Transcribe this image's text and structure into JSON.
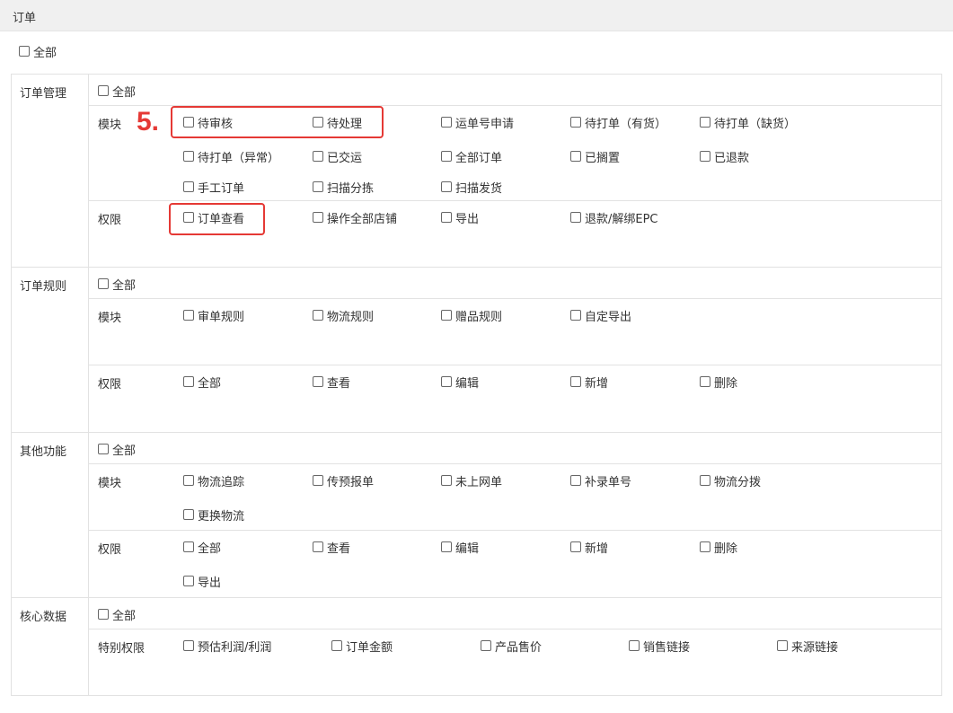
{
  "header": {
    "title": "订单"
  },
  "top_all": "全部",
  "annotation": {
    "step": "5."
  },
  "sections": [
    {
      "name": "订单管理",
      "all": "全部",
      "rows": [
        {
          "label": "模块",
          "items": [
            "待审核",
            "待处理",
            "运单号申请",
            "待打单（有货）",
            "待打单（缺货）",
            "待打单（异常）",
            "已交运",
            "全部订单",
            "已搁置",
            "已退款",
            "手工订单",
            "扫描分拣",
            "扫描发货"
          ]
        },
        {
          "label": "权限",
          "items": [
            "订单查看",
            "操作全部店铺",
            "导出",
            "退款/解绑EPC"
          ]
        }
      ]
    },
    {
      "name": "订单规则",
      "all": "全部",
      "rows": [
        {
          "label": "模块",
          "items": [
            "审单规则",
            "物流规则",
            "赠品规则",
            "自定导出"
          ]
        },
        {
          "label": "权限",
          "items": [
            "全部",
            "查看",
            "编辑",
            "新增",
            "删除"
          ]
        }
      ]
    },
    {
      "name": "其他功能",
      "all": "全部",
      "rows": [
        {
          "label": "模块",
          "items": [
            "物流追踪",
            "传预报单",
            "未上网单",
            "补录单号",
            "物流分拨",
            "更换物流"
          ]
        },
        {
          "label": "权限",
          "items": [
            "全部",
            "查看",
            "编辑",
            "新增",
            "删除",
            "导出"
          ]
        }
      ]
    },
    {
      "name": "核心数据",
      "all": "全部",
      "rows": [
        {
          "label": "特别权限",
          "items": [
            "预估利润/利润",
            "订单金额",
            "产品售价",
            "销售链接",
            "来源链接"
          ]
        }
      ]
    }
  ]
}
